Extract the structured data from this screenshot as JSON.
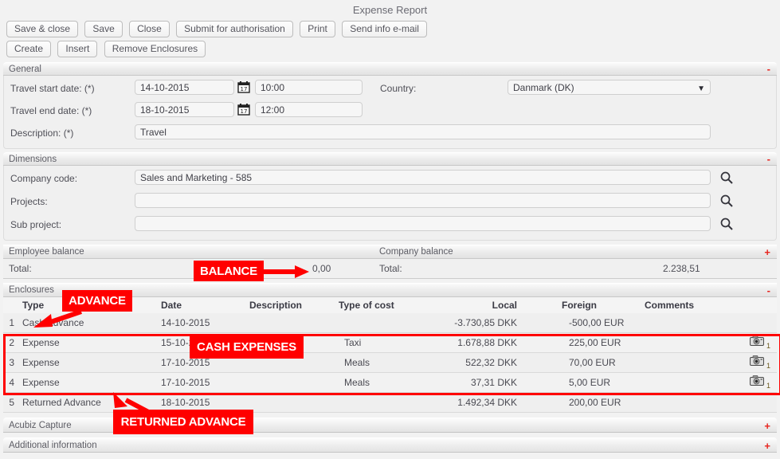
{
  "window": {
    "title": "Expense Report"
  },
  "toolbar_primary": {
    "buttons": [
      {
        "label": "Save & close"
      },
      {
        "label": "Save"
      },
      {
        "label": "Close"
      },
      {
        "label": "Submit for authorisation"
      },
      {
        "label": "Print"
      },
      {
        "label": "Send info e-mail"
      }
    ]
  },
  "toolbar_secondary": {
    "buttons": [
      {
        "label": "Create"
      },
      {
        "label": "Insert"
      },
      {
        "label": "Remove Enclosures"
      }
    ]
  },
  "general": {
    "section_title": "General",
    "toggle": "-",
    "travel_start_label": "Travel start date: (*)",
    "travel_start_date": "14-10-2015",
    "travel_start_time": "10:00",
    "travel_end_label": "Travel end date: (*)",
    "travel_end_date": "18-10-2015",
    "travel_end_time": "12:00",
    "description_label": "Description: (*)",
    "description_value": "Travel",
    "country_label": "Country:",
    "country_value": "Danmark (DK)",
    "calendar_icon": "calendar-icon",
    "caret": "▼"
  },
  "dimensions": {
    "section_title": "Dimensions",
    "toggle": "-",
    "company_code_label": "Company code:",
    "company_code_value": "Sales and Marketing - 585",
    "projects_label": "Projects:",
    "projects_value": "",
    "sub_project_label": "Sub project:",
    "sub_project_value": "",
    "search_icon": "search-icon"
  },
  "balance": {
    "employee_title": "Employee balance",
    "company_title": "Company balance",
    "toggle": "+",
    "employee_total_label": "Total:",
    "employee_total_value": "0,00",
    "company_total_label": "Total:",
    "company_total_value": "2.238,51"
  },
  "enclosures": {
    "section_title": "Enclosures",
    "toggle": "-",
    "columns": [
      "Type",
      "Date",
      "Description",
      "Type of cost",
      "Local",
      "Foreign",
      "Comments"
    ],
    "rows": [
      {
        "num": "1",
        "type": "Cash Advance",
        "date": "14-10-2015",
        "description": "",
        "type_of_cost": "",
        "local": "-3.730,85 DKK",
        "foreign": "-500,00 EUR",
        "comments": "",
        "attachment": null
      },
      {
        "num": "2",
        "type": "Expense",
        "date": "15-10-2015",
        "description": "",
        "type_of_cost": "Taxi",
        "local": "1.678,88 DKK",
        "foreign": "225,00 EUR",
        "comments": "",
        "attachment": {
          "icon": "camera-icon",
          "count": "1"
        }
      },
      {
        "num": "3",
        "type": "Expense",
        "date": "17-10-2015",
        "description": "",
        "type_of_cost": "Meals",
        "local": "522,32 DKK",
        "foreign": "70,00 EUR",
        "comments": "",
        "attachment": {
          "icon": "camera-icon",
          "count": "1"
        }
      },
      {
        "num": "4",
        "type": "Expense",
        "date": "17-10-2015",
        "description": "",
        "type_of_cost": "Meals",
        "local": "37,31 DKK",
        "foreign": "5,00 EUR",
        "comments": "",
        "attachment": {
          "icon": "camera-icon",
          "count": "1"
        }
      },
      {
        "num": "5",
        "type": "Returned Advance",
        "date": "18-10-2015",
        "description": "",
        "type_of_cost": "",
        "local": "1.492,34 DKK",
        "foreign": "200,00 EUR",
        "comments": "",
        "attachment": null
      }
    ]
  },
  "acubiz_capture": {
    "title": "Acubiz Capture",
    "toggle": "+"
  },
  "additional_information": {
    "title": "Additional information",
    "toggle": "+"
  },
  "annotations": {
    "color": "#ff0000",
    "balance": "BALANCE",
    "advance": "ADVANCE",
    "cash_expenses": "CASH EXPENSES",
    "returned_advance": "RETURNED ADVANCE"
  }
}
